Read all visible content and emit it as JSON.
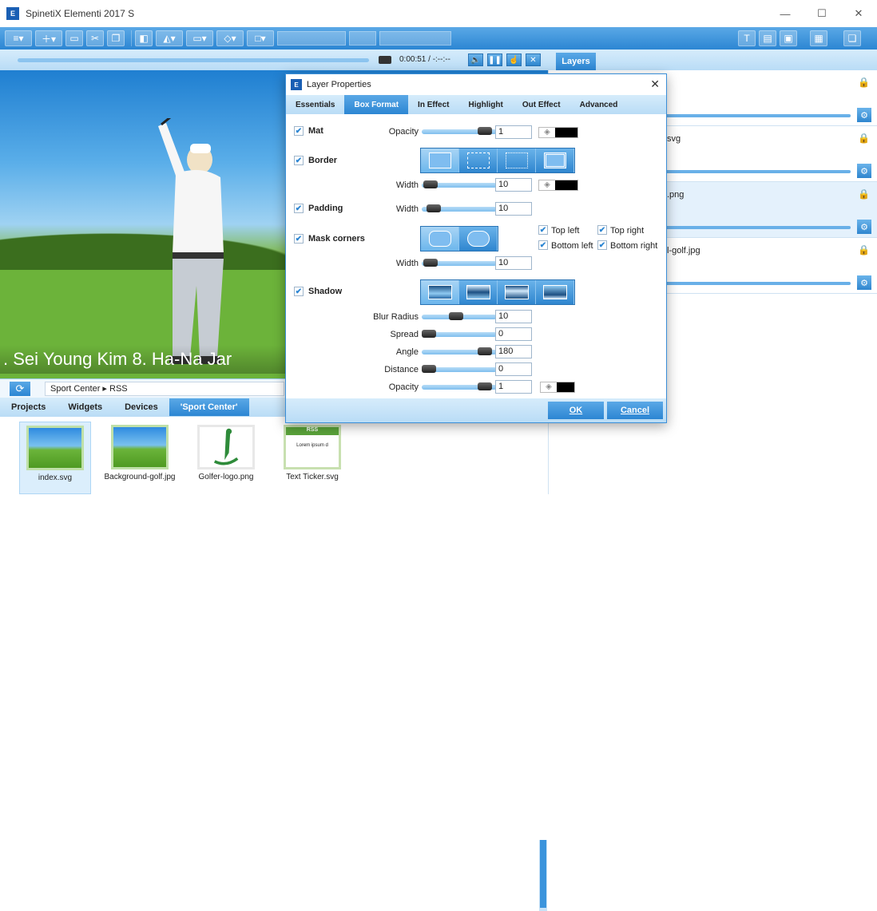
{
  "window": {
    "title": "SpinetiX Elementi 2017 S",
    "app_icon": "E",
    "minimize": "—",
    "maximize": "☐",
    "close": "✕"
  },
  "playback": {
    "time": "0:00:51 / -:--:--"
  },
  "layers": {
    "tab_label": "Layers",
    "items": [
      {
        "name": ""
      },
      {
        "name": "svg"
      },
      {
        "name": ".png"
      },
      {
        "name": "l-golf.jpg"
      }
    ]
  },
  "preview": {
    "caption": ". Sei Young Kim    8. Ha-Na Jar"
  },
  "path_bar": {
    "path": "Sport Center  ▸  RSS"
  },
  "bottom_tabs": [
    "Projects",
    "Widgets",
    "Devices",
    "'Sport Center'"
  ],
  "assets": [
    {
      "label": "index.svg"
    },
    {
      "label": "Background-golf.jpg"
    },
    {
      "label": "Golfer-logo.png"
    },
    {
      "label": "Text Ticker.svg"
    }
  ],
  "rss_thumb": {
    "title": "RSS",
    "text": "Lorem ipsum d"
  },
  "dialog": {
    "title": "Layer Properties",
    "icon": "E",
    "tabs": [
      "Essentials",
      "Box Format",
      "In Effect",
      "Highlight",
      "Out Effect",
      "Advanced"
    ],
    "active_tab": "Box Format",
    "mat": {
      "label": "Mat",
      "opacity_label": "Opacity",
      "opacity": "1",
      "color": "#000000"
    },
    "border": {
      "label": "Border",
      "width_label": "Width",
      "width": "10",
      "color": "#000000"
    },
    "padding": {
      "label": "Padding",
      "width_label": "Width",
      "width": "10"
    },
    "mask": {
      "label": "Mask corners",
      "width_label": "Width",
      "width": "10",
      "corners": {
        "top_left": "Top left",
        "top_right": "Top right",
        "bottom_left": "Bottom left",
        "bottom_right": "Bottom right"
      }
    },
    "shadow": {
      "label": "Shadow",
      "blur_label": "Blur Radius",
      "blur": "10",
      "spread_label": "Spread",
      "spread": "0",
      "angle_label": "Angle",
      "angle": "180",
      "distance_label": "Distance",
      "distance": "0",
      "opacity_label": "Opacity",
      "opacity": "1",
      "color": "#000000"
    },
    "ok": "OK",
    "cancel": "Cancel"
  },
  "colors": {
    "accent": "#2c86d3",
    "accent_light": "#b9dcf6"
  }
}
